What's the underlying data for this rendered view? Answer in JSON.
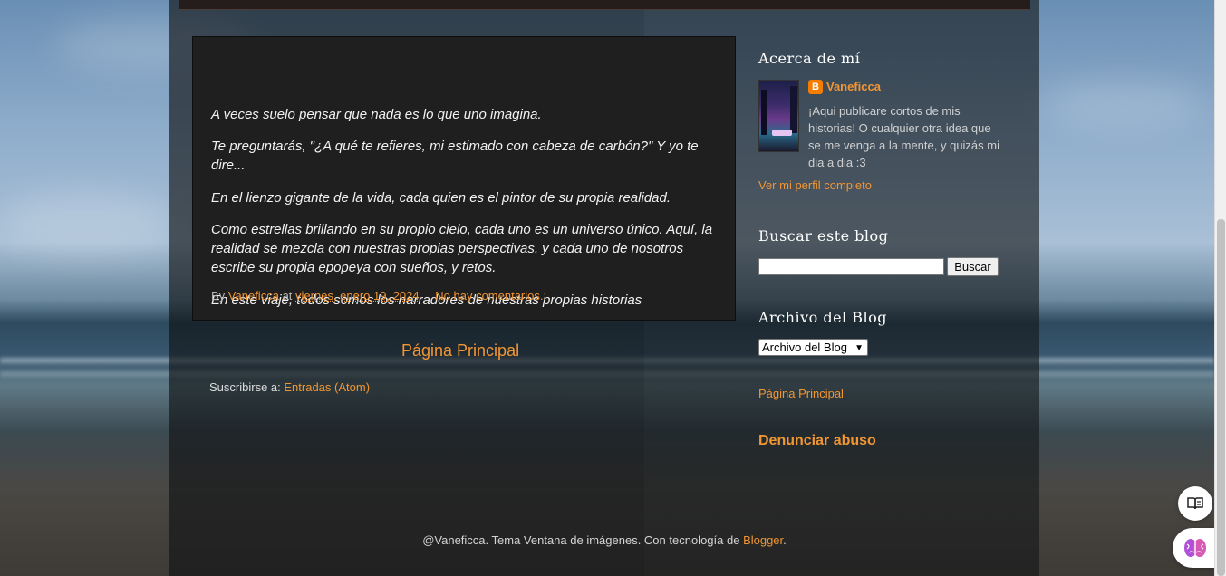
{
  "post": {
    "paragraphs": [
      " A veces suelo pensar que nada es lo que uno imagina.",
      "Te preguntarás, \"¿A qué te refieres, mi estimado con cabeza de carbón?\" Y yo te dire...",
      "En el lienzo gigante de la vida, cada quien es el pintor de su propia realidad.",
      "Como estrellas brillando en su propio cielo, cada uno es un universo único. Aquí, la realidad se mezcla con nuestras propias perspectivas, y cada uno de nosotros escribe su propia epopeya con sueños, y retos.",
      " En este viaje, todos somos los narradores de nuestras propias historias"
    ],
    "footer": {
      "by_label": "By",
      "author": "Vaneficca",
      "at_label": "at",
      "date": "viernes, enero 19, 2024",
      "comments": "No hay comentarios.:"
    }
  },
  "home_link": "Página Principal",
  "subscribe": {
    "label": "Suscribirse a:",
    "link": "Entradas (Atom)"
  },
  "sidebar": {
    "about": {
      "title": "Acerca de mí",
      "name": "Vaneficca",
      "description": "¡Aqui publicare cortos de mis historias! O cualquier otra idea que se me venga a la mente, y quizás mi dia a dia :3",
      "profile_link": "Ver mi perfil completo"
    },
    "search": {
      "title": "Buscar este blog",
      "input_value": "",
      "button_label": "Buscar"
    },
    "archive": {
      "title": "Archivo del Blog",
      "selected": "Archivo del Blog"
    },
    "home_link": "Página Principal",
    "report_abuse": "Denunciar abuso"
  },
  "footer": {
    "text": "@Vaneficca. Tema Ventana de imágenes. Con tecnología de ",
    "link": "Blogger",
    "suffix": "."
  },
  "colors": {
    "link": "#f29633",
    "post_bg": "#1f1f1f",
    "blogger_brand": "#f57d00"
  },
  "icons": {
    "blogger": "blogger-icon",
    "reader": "reader-mode-icon",
    "assistant": "brain-icon",
    "select_caret": "chevron-down-icon"
  }
}
